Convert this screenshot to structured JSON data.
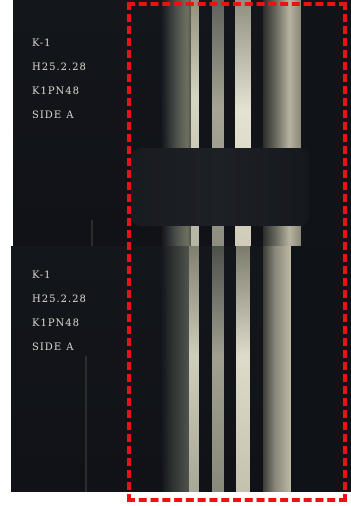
{
  "images": [
    {
      "lines": [
        "K-1",
        "H25.2.28",
        "K1PN48",
        "SIDE A"
      ]
    },
    {
      "lines": [
        "K-1",
        "H25.2.28",
        "K1PN48",
        "SIDE A"
      ]
    }
  ],
  "highlight": {
    "color": "#ee1111",
    "style": "dashed"
  }
}
